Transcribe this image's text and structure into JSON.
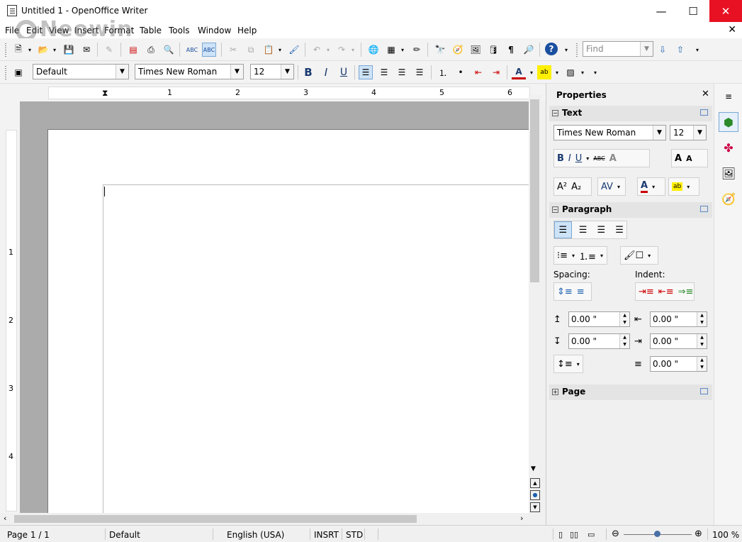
{
  "window": {
    "title": "Untitled 1 - OpenOffice Writer",
    "minimize": "—",
    "maximize": "☐",
    "close": "✕",
    "doc_close": "✕"
  },
  "watermark": "Neowin",
  "menubar": {
    "items": [
      "File",
      "Edit",
      "View",
      "Insert",
      "Format",
      "Table",
      "Tools",
      "Window",
      "Help"
    ]
  },
  "standard_toolbar": {
    "find_placeholder": "Find"
  },
  "formatting_toolbar": {
    "paragraph_style": "Default",
    "font_name": "Times New Roman",
    "font_size": "12"
  },
  "ruler": {
    "h_numbers": [
      "1",
      "2",
      "3",
      "4",
      "5",
      "6"
    ],
    "v_numbers": [
      "1",
      "2",
      "3",
      "4"
    ]
  },
  "sidebar": {
    "title": "Properties",
    "close": "✕",
    "text_panel": {
      "title": "Text",
      "font_name": "Times New Roman",
      "font_size": "12"
    },
    "paragraph_panel": {
      "title": "Paragraph",
      "spacing_label": "Spacing:",
      "indent_label": "Indent:",
      "above_spacing": "0.00 \"",
      "below_spacing": "0.00 \"",
      "before_indent": "0.00 \"",
      "after_indent": "0.00 \"",
      "first_line_indent": "0.00 \""
    },
    "page_panel": {
      "title": "Page"
    }
  },
  "statusbar": {
    "page": "Page 1 / 1",
    "style": "Default",
    "language": "English (USA)",
    "insert_mode": "INSRT",
    "selection_mode": "STD",
    "zoom": "100 %"
  },
  "colors": {
    "close_red": "#e81123",
    "accent": "#cde3f7",
    "canvas": "#ababab"
  }
}
